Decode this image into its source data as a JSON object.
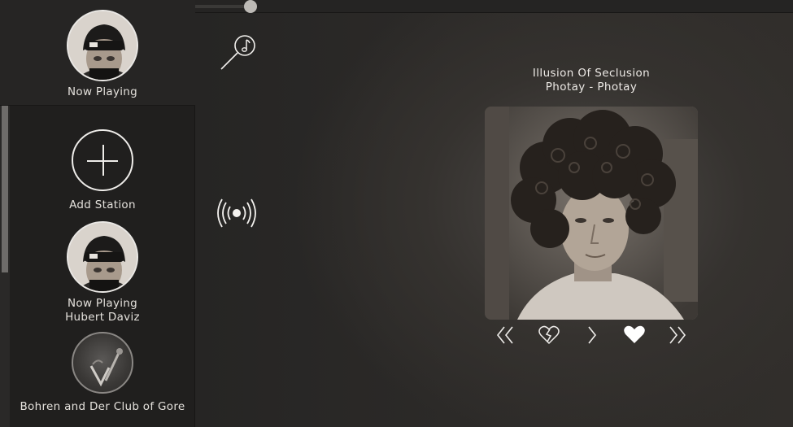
{
  "sidebar": {
    "now_playing_header": {
      "label": "Now Playing"
    },
    "stations": [
      {
        "label": "Add Station"
      },
      {
        "label": "Now Playing\nHubert Daviz"
      },
      {
        "label": "Bohren and Der Club of Gore"
      }
    ]
  },
  "player": {
    "progress_fraction": 0.093,
    "track_title": "Illusion Of Seclusion",
    "track_artist": "Photay - Photay"
  },
  "icons": {
    "search": "music-search-icon",
    "radio": "broadcast-icon",
    "previous": "double-chevron-left-icon",
    "dislike": "broken-heart-icon",
    "play": "chevron-right-icon",
    "like": "heart-icon",
    "skip": "double-chevron-right-icon"
  },
  "colors": {
    "accent": "#ffffff",
    "background": "#2b2927"
  }
}
